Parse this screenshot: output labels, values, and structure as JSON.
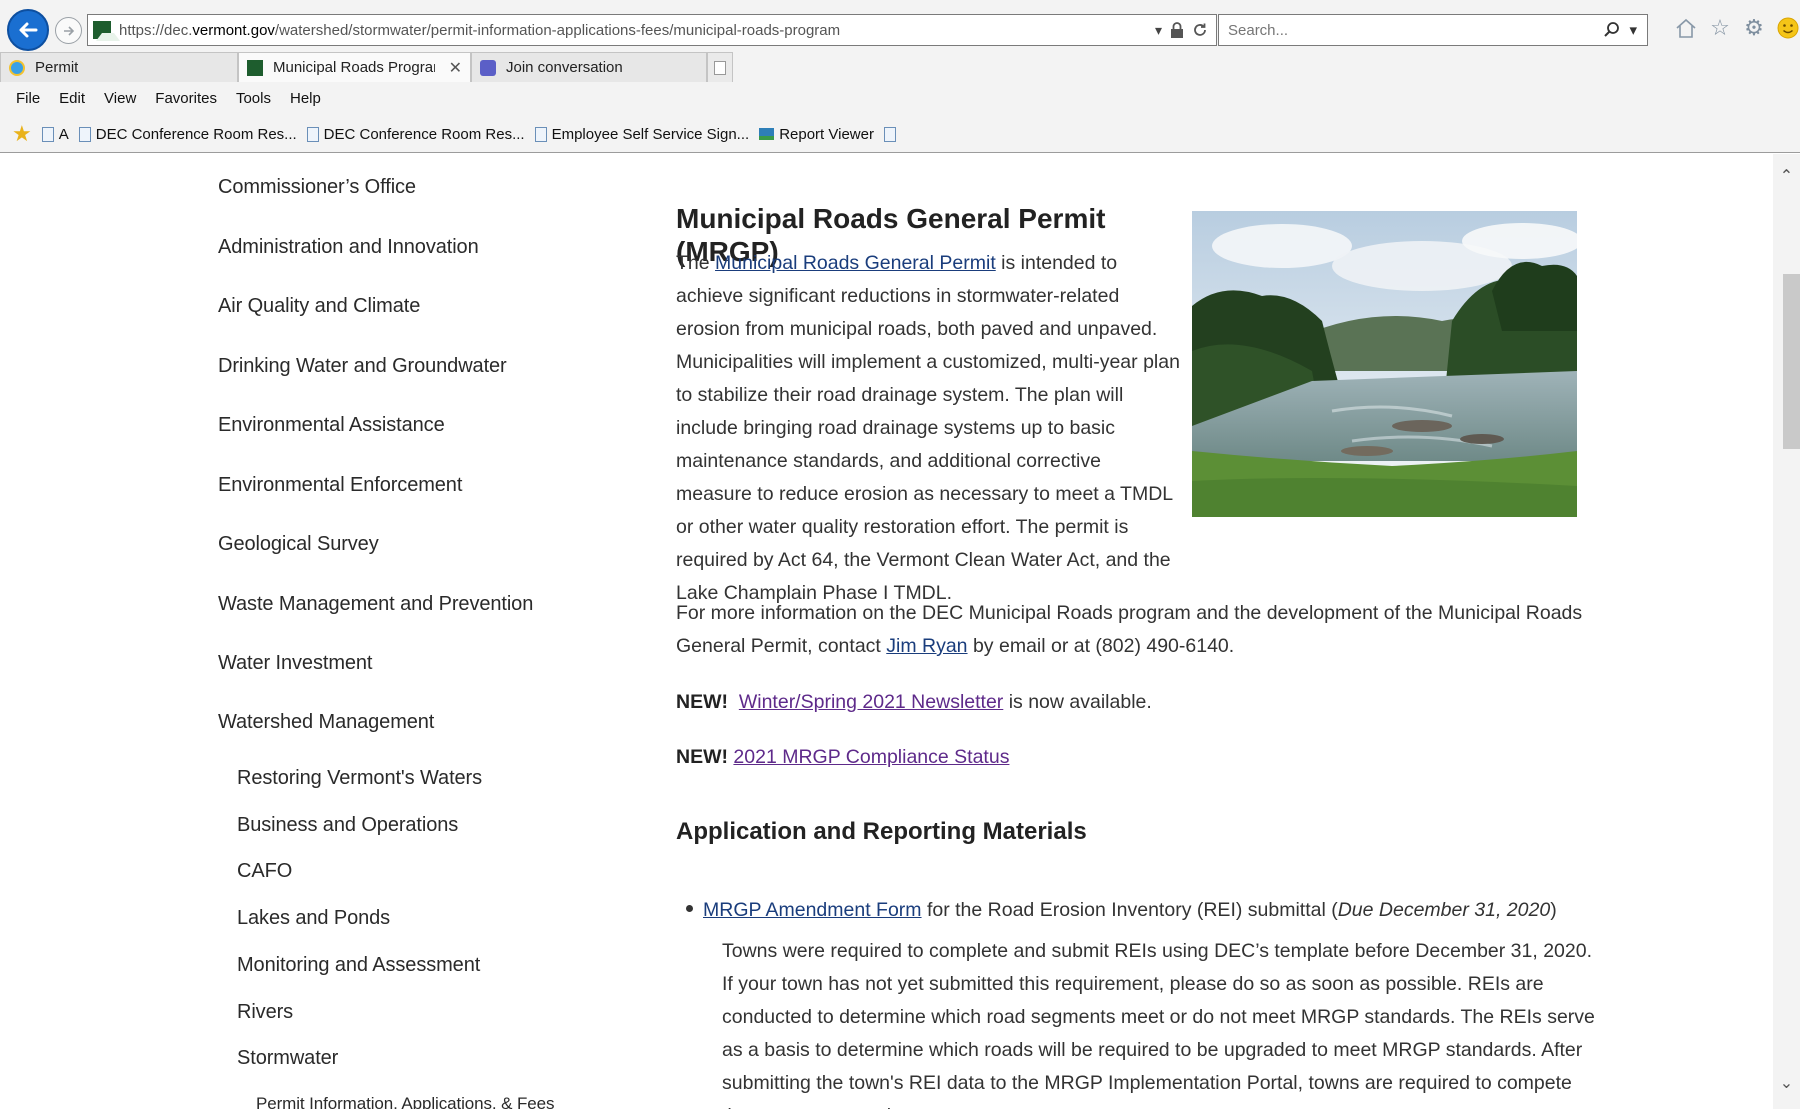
{
  "browser": {
    "url_prefix": "https://dec.",
    "url_host": "vermont.gov",
    "url_path": "/watershed/stormwater/permit-information-applications-fees/municipal-roads-program",
    "search_placeholder": "Search...",
    "tabs": [
      {
        "label": "Permit"
      },
      {
        "label": "Municipal Roads Program | ..."
      },
      {
        "label": "Join conversation"
      }
    ],
    "menu": [
      "File",
      "Edit",
      "View",
      "Favorites",
      "Tools",
      "Help"
    ],
    "favorites": [
      "A",
      "DEC Conference Room Res...",
      "DEC Conference Room Res...",
      "Employee Self Service Sign...",
      "Report Viewer"
    ]
  },
  "sidebar": {
    "items": [
      "Commissioner’s Office",
      "Administration and Innovation",
      "Air Quality and Climate",
      "Drinking Water and Groundwater",
      "Environmental Assistance",
      "Environmental Enforcement",
      "Geological Survey",
      "Waste Management and Prevention",
      "Water Investment",
      "Watershed Management"
    ],
    "subitems": [
      "Restoring Vermont's Waters",
      "Business and Operations",
      "CAFO",
      "Lakes and Ponds",
      "Monitoring and Assessment",
      "Rivers",
      "Stormwater"
    ],
    "subsubitems": [
      "Permit Information, Applications, & Fees"
    ]
  },
  "main": {
    "title": "Municipal Roads General Permit (MRGP)",
    "intro_before": "The ",
    "intro_link": "Municipal Roads General Permit",
    "intro_after": " is intended to achieve significant reductions in stormwater-related erosion from municipal roads, both paved and unpaved. Municipalities will implement a customized, multi-year plan to stabilize their road drainage system. The plan will include bringing road drainage systems up to basic maintenance standards, and additional corrective measure to reduce erosion as necessary to meet a TMDL or other water quality restoration effort. The permit is required by Act 64, the Vermont Clean Water Act, and the Lake Champlain Phase I TMDL.",
    "contact_before": "For more information on the DEC Municipal Roads program and the development of the Municipal Roads General Permit, contact ",
    "contact_link": "Jim Ryan",
    "contact_after": " by email or at (802) 490-6140.",
    "new1_label": "NEW!",
    "new1_link": "Winter/Spring 2021 Newsletter",
    "new1_after": " is now available.",
    "new2_label": "NEW!",
    "new2_link": "2021 MRGP Compliance Status",
    "section_title": "Application and Reporting Materials",
    "bullet_link": "MRGP Amendment Form",
    "bullet_text": " for the Road Erosion Inventory (REI) submittal (",
    "bullet_due": "Due December 31, 2020",
    "bullet_close": ")",
    "bullet_para": "Towns were required to complete and submit REIs using DEC’s template before December 31, 2020. If your town has not yet submitted this requirement, please do so as soon as possible. REIs are conducted to determine which road segments meet or do not meet MRGP standards. The REIs serve as a basis to determine which roads will be required to be upgraded to meet MRGP standards.  After submitting the town's REI data to the MRGP Implementation Portal, towns are required to compete the one-page permit"
  },
  "colors": {
    "link": "#1a3d7c",
    "visited_link": "#5e2a8a",
    "back_button": "#1a6fd1"
  }
}
